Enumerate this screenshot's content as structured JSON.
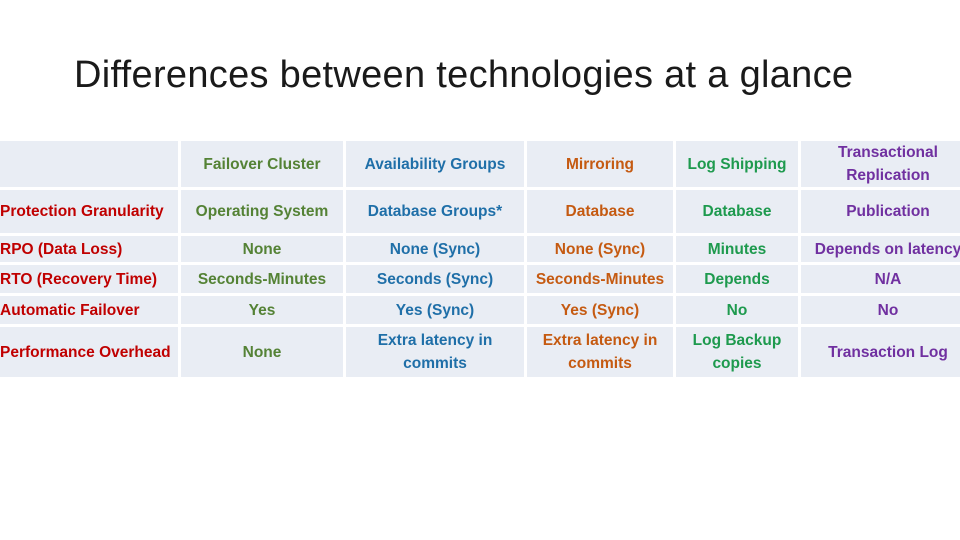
{
  "slide": {
    "title": "Differences between technologies at a glance"
  },
  "colors": {
    "row_label": "#c00000",
    "failover_cluster": "#548235",
    "availability_groups": "#1f6fa8",
    "mirroring": "#c55a11",
    "log_shipping": "#1e9a4e",
    "transactional_replication": "#7030a0",
    "cell_background": "#e9edf4"
  },
  "table": {
    "corner": "",
    "columns": [
      "Failover Cluster",
      "Availability Groups",
      "Mirroring",
      "Log Shipping",
      "Transactional Replication"
    ],
    "rows": [
      {
        "label": "Protection Granularity",
        "values": [
          "Operating System",
          "Database Groups*",
          "Database",
          "Database",
          "Publication"
        ]
      },
      {
        "label": "RPO (Data Loss)",
        "values": [
          "None",
          "None (Sync)",
          "None (Sync)",
          "Minutes",
          "Depends on latency"
        ]
      },
      {
        "label": "RTO (Recovery Time)",
        "values": [
          "Seconds-Minutes",
          "Seconds (Sync)",
          "Seconds-Minutes",
          "Depends",
          "N/A"
        ]
      },
      {
        "label": "Automatic Failover",
        "values": [
          "Yes",
          "Yes (Sync)",
          "Yes (Sync)",
          "No",
          "No"
        ]
      },
      {
        "label": "Performance Overhead",
        "values": [
          "None",
          "Extra latency in commits",
          "Extra latency in commits",
          "Log Backup copies",
          "Transaction Log"
        ]
      }
    ]
  }
}
